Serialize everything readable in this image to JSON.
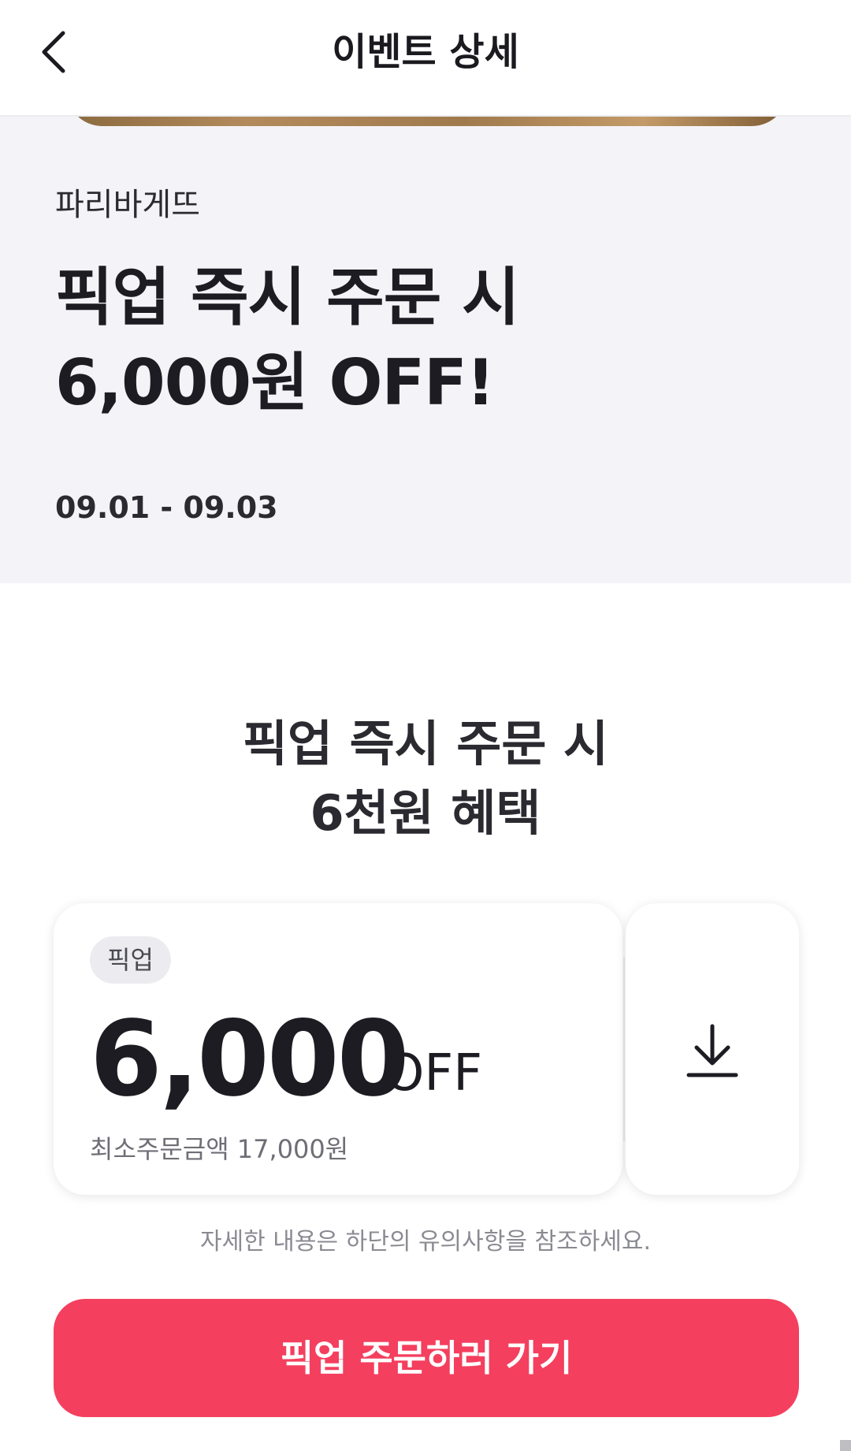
{
  "header": {
    "title": "이벤트 상세",
    "back_icon": "chevron-left-icon"
  },
  "hero": {
    "brand": "파리바게뜨",
    "title_line1": "픽업 즉시 주문 시",
    "title_line2": "6,000원 OFF!",
    "date_range": "09.01 - 09.03"
  },
  "benefit": {
    "heading_line1": "픽업 즉시 주문 시",
    "heading_line2": "6천원 혜택"
  },
  "coupon": {
    "badge": "픽업",
    "amount": "6,000",
    "unit": "OFF",
    "min_order": "최소주문금액 17,000원",
    "download_icon": "download-icon"
  },
  "note": "자세한 내용은 하단의 유의사항을 참조하세요.",
  "cta_label": "픽업 주문하러 가기",
  "colors": {
    "accent": "#f43f5e",
    "hero_bg": "#f4f3f8",
    "text": "#1c1c22"
  }
}
